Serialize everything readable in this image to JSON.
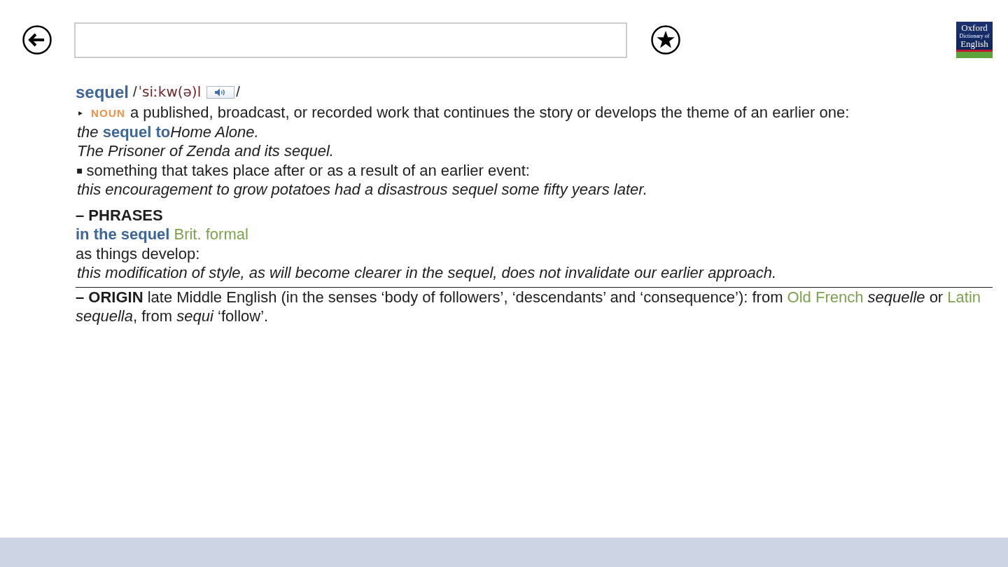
{
  "toolbar": {
    "items": [
      {
        "kind": "back"
      },
      {
        "kind": "search"
      },
      {
        "kind": "favorite"
      }
    ]
  },
  "logo": {
    "lines": [
      "Oxford",
      "Dictionary of",
      "English"
    ]
  },
  "entry": {
    "headword": "sequel",
    "pronunciation": {
      "open": "/",
      "text": "ˈsiːkw(ə)l",
      "close": "/"
    },
    "senses": [
      {
        "marker": "▸",
        "part_of_speech": "NOUN",
        "definition": "a published, broadcast, or recorded work that continues the story or develops the theme of an earlier one:",
        "examples": [
          {
            "parts": [
              {
                "kind": "text",
                "text": "the "
              },
              {
                "kind": "collocation",
                "text": "sequel to"
              },
              {
                "kind": "text",
                "text": "Home Alone."
              }
            ]
          },
          {
            "parts": [
              {
                "kind": "text",
                "text": "The Prisoner of Zenda and its sequel."
              }
            ]
          }
        ]
      },
      {
        "marker": "▪",
        "definition": "something that takes place after or as a result of an earlier event:",
        "examples": [
          {
            "parts": [
              {
                "kind": "text",
                "text": "this encouragement to grow potatoes had a disastrous sequel some fifty years later."
              }
            ]
          }
        ]
      }
    ],
    "phrases": {
      "heading": "– PHRASES",
      "items": [
        {
          "phrase": "in the sequel",
          "register": "Brit. formal",
          "definition": "as things develop:",
          "examples": [
            {
              "parts": [
                {
                  "kind": "text",
                  "text": "this modification of style, as will become clearer in the sequel, does not invalidate our earlier approach."
                }
              ]
            }
          ]
        }
      ]
    },
    "origin": {
      "label": "– ORIGIN",
      "parts": [
        {
          "kind": "text",
          "text": "late Middle English (in the senses ‘body of followers’, ‘descendants’ and ‘consequence’): from "
        },
        {
          "kind": "language",
          "text": "Old French"
        },
        {
          "kind": "text",
          "text": " *sequelle* or "
        },
        {
          "kind": "language",
          "text": "Latin"
        },
        {
          "kind": "text",
          "text": " *sequella*, from *sequi* ‘follow’."
        }
      ]
    }
  }
}
